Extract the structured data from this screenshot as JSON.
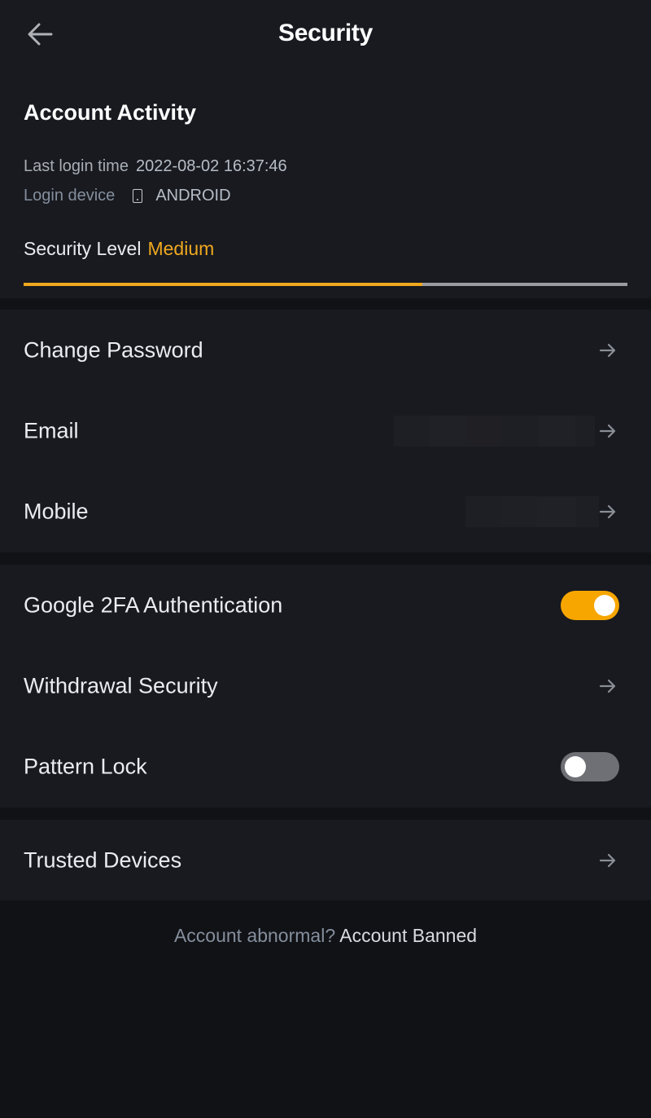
{
  "header": {
    "title": "Security",
    "back_icon": "arrow-left-icon"
  },
  "account_activity": {
    "title": "Account Activity",
    "last_login_label": "Last login time",
    "last_login_value": "2022-08-02 16:37:46",
    "login_device_label": "Login device",
    "login_device_icon": "mobile-device-icon",
    "login_device_value": "ANDROID",
    "security_level_label": "Security Level",
    "security_level_value": "Medium",
    "security_level_progress": 0.66,
    "colors": {
      "accent": "#F0A81E",
      "track": "#9A9CA2"
    }
  },
  "sections": [
    {
      "items": [
        {
          "label": "Change Password",
          "control": "arrow",
          "icon": "arrow-right-icon"
        },
        {
          "label": "Email",
          "control": "arrow",
          "value_masked": true,
          "icon": "arrow-right-icon"
        },
        {
          "label": "Mobile",
          "control": "arrow",
          "value_masked": true,
          "icon": "arrow-right-icon"
        }
      ]
    },
    {
      "items": [
        {
          "label": "Google 2FA Authentication",
          "control": "toggle",
          "checked": true
        },
        {
          "label": "Withdrawal Security",
          "control": "arrow",
          "icon": "arrow-right-icon"
        },
        {
          "label": "Pattern Lock",
          "control": "toggle",
          "checked": false
        }
      ]
    },
    {
      "items": [
        {
          "label": "Trusted Devices",
          "control": "arrow",
          "icon": "arrow-right-icon"
        }
      ]
    }
  ],
  "footer": {
    "question": "Account abnormal?",
    "link": "Account Banned"
  },
  "colors": {
    "background": "#111216",
    "card": "#181A20",
    "toggle_on": "#F7A600",
    "toggle_off": "#6E7076"
  }
}
